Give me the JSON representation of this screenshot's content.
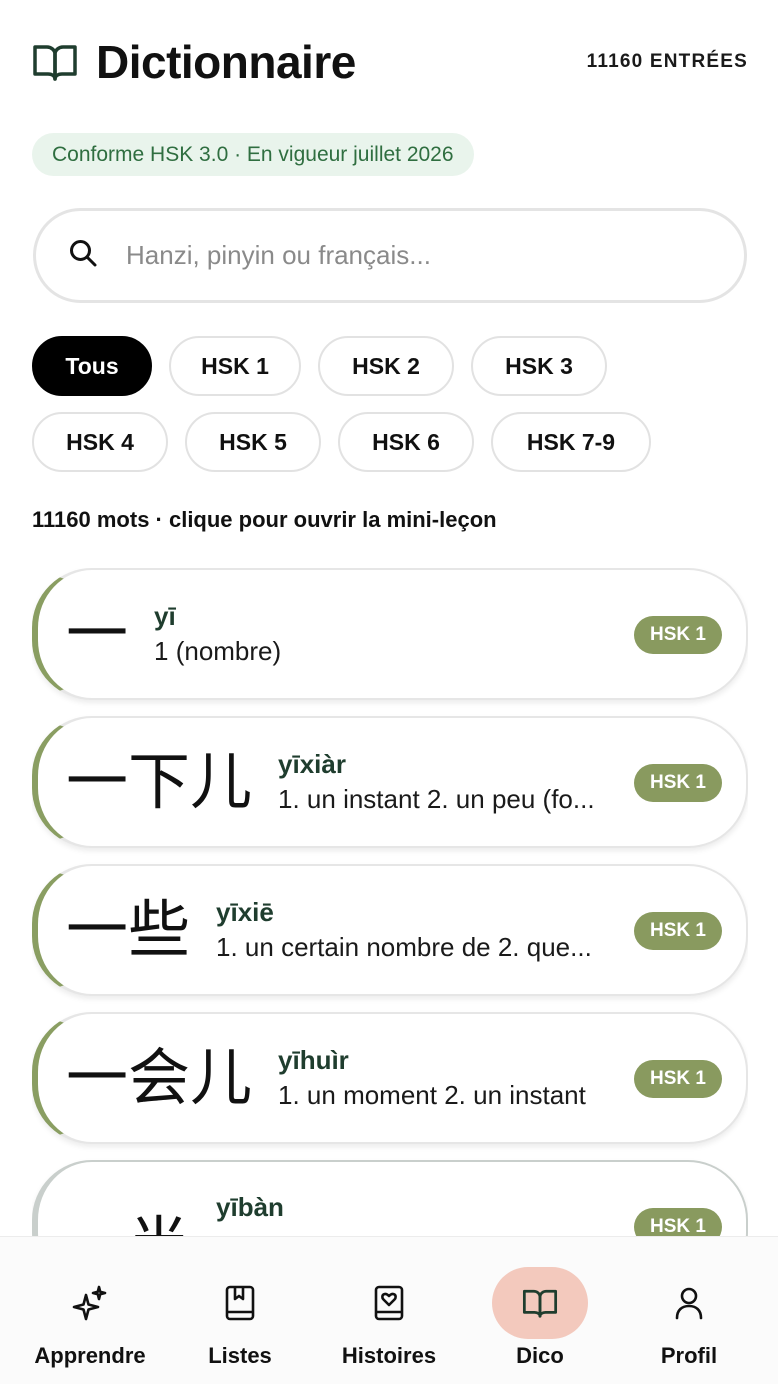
{
  "header": {
    "title": "Dictionnaire",
    "entries": "11160 ENTRÉES",
    "icon": "open-book-icon"
  },
  "conformity_badge": "Conforme HSK 3.0 · En vigueur juillet 2026",
  "search": {
    "placeholder": "Hanzi, pinyin ou français...",
    "value": "",
    "icon": "search-icon"
  },
  "filters": {
    "row1": [
      "Tous",
      "HSK 1",
      "HSK 2",
      "HSK 3"
    ],
    "row2": [
      "HSK 4",
      "HSK 5",
      "HSK 6",
      "HSK 7-9"
    ],
    "selected": "Tous"
  },
  "count_line": "11160 mots · clique pour ouvrir la mini-leçon",
  "words": [
    {
      "hanzi": "一",
      "pinyin": "yī",
      "definition": "1 (nombre)",
      "level": "HSK 1"
    },
    {
      "hanzi": "一下儿",
      "pinyin": "yīxiàr",
      "definition": "1. un instant 2. un peu (fo...",
      "level": "HSK 1"
    },
    {
      "hanzi": "一些",
      "pinyin": "yīxiē",
      "definition": "1. un certain nombre de 2. que...",
      "level": "HSK 1"
    },
    {
      "hanzi": "一会儿",
      "pinyin": "yīhuìr",
      "definition": "1. un moment 2. un instant",
      "level": "HSK 1"
    },
    {
      "hanzi": "一半",
      "pinyin": "yībàn",
      "definition": "",
      "level": "HSK 1"
    }
  ],
  "colors": {
    "accent_green": "#899a5f",
    "badge_bg": "#e9f4ec",
    "badge_text": "#2f6e40",
    "active_nav_bg": "#f3c9bd"
  },
  "nav": {
    "items": [
      {
        "label": "Apprendre",
        "icon": "sparkles-icon"
      },
      {
        "label": "Listes",
        "icon": "bookmark-book-icon"
      },
      {
        "label": "Histoires",
        "icon": "heart-book-icon"
      },
      {
        "label": "Dico",
        "icon": "open-book-icon"
      },
      {
        "label": "Profil",
        "icon": "user-icon"
      }
    ],
    "active": "Dico"
  }
}
